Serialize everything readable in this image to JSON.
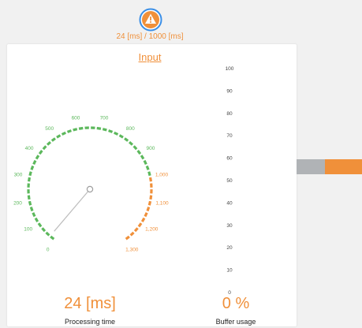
{
  "warning": {
    "icon": "warning-icon",
    "text": "24 [ms] / 1000 [ms]",
    "color": "#f0903a"
  },
  "card": {
    "title": "Input"
  },
  "gauge": {
    "min": 0,
    "max": 1300,
    "warn_from": 1000,
    "value": 24,
    "ticks": [
      "0",
      "100",
      "200",
      "300",
      "400",
      "500",
      "600",
      "700",
      "800",
      "900",
      "1,000",
      "1,100",
      "1,200",
      "1,300"
    ],
    "ok_color": "#5cb85c",
    "warn_color": "#f0903a",
    "readout": "24 [ms]",
    "label": "Processing time"
  },
  "buffer": {
    "ticks": [
      "100",
      "90",
      "80",
      "70",
      "60",
      "50",
      "40",
      "30",
      "20",
      "10",
      "0"
    ],
    "value_percent": 0,
    "readout": "0 %",
    "label": "Buffer usage"
  },
  "flow": {
    "gray_color": "#b0b3b6",
    "orange_color": "#f0903a"
  }
}
